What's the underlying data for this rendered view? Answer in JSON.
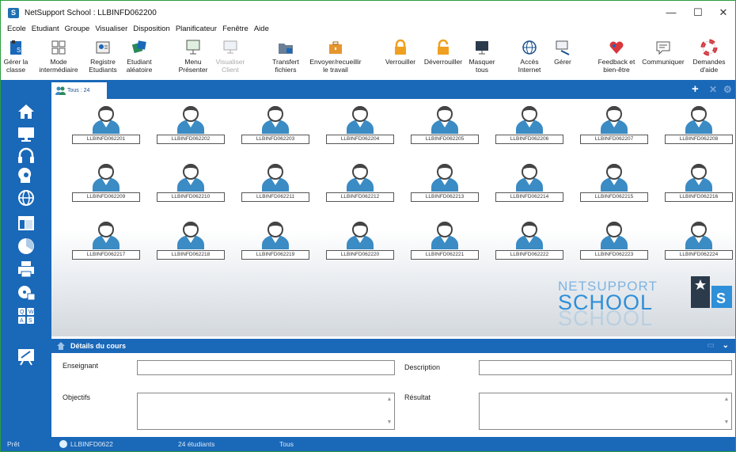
{
  "window": {
    "title": "NetSupport School : LLBINFD062200",
    "app_icon_letter": "S",
    "minimize": "—",
    "maximize": "☐",
    "close": "✕"
  },
  "menu": [
    "Ecole",
    "Etudiant",
    "Groupe",
    "Visualiser",
    "Disposition",
    "Planificateur",
    "Fenêtre",
    "Aide"
  ],
  "ribbon": [
    {
      "l1": "Gérer la",
      "l2": "classe"
    },
    {
      "l1": "Mode",
      "l2": "intermédiaire"
    },
    {
      "l1": "Registre",
      "l2": "Etudiants"
    },
    {
      "l1": "Etudiant",
      "l2": "aléatoire"
    },
    {
      "l1": "Menu",
      "l2": "Présenter"
    },
    {
      "l1": "Visualiser",
      "l2": "Client"
    },
    {
      "l1": "Transfert",
      "l2": "fichiers"
    },
    {
      "l1": "Envoyer/recueillir",
      "l2": "le travail"
    },
    {
      "l1": "Verrouiller",
      "l2": ""
    },
    {
      "l1": "Déverrouiller",
      "l2": ""
    },
    {
      "l1": "Masquer",
      "l2": "tous"
    },
    {
      "l1": "Accès",
      "l2": "Internet"
    },
    {
      "l1": "Gérer",
      "l2": ""
    },
    {
      "l1": "Feedback et",
      "l2": "bien-être"
    },
    {
      "l1": "Communiquer",
      "l2": ""
    },
    {
      "l1": "Demandes",
      "l2": "d'aide"
    }
  ],
  "tab": {
    "label": "Tous : 24",
    "add": "+",
    "close": "✕",
    "settings": "⚙"
  },
  "stations": [
    "LLBINFD062201",
    "LLBINFD062202",
    "LLBINFD062203",
    "LLBINFD062204",
    "LLBINFD062205",
    "LLBINFD062206",
    "LLBINFD062207",
    "LLBINFD062208",
    "LLBINFD062209",
    "LLBINFD062210",
    "LLBINFD062211",
    "LLBINFD062212",
    "LLBINFD062213",
    "LLBINFD062214",
    "LLBINFD062215",
    "LLBINFD062216",
    "LLBINFD062217",
    "LLBINFD062218",
    "LLBINFD062219",
    "LLBINFD062220",
    "LLBINFD062221",
    "LLBINFD062222",
    "LLBINFD062223",
    "LLBINFD062224"
  ],
  "logo": {
    "line1": "NETSUPPORT",
    "line2": "SCHOOL",
    "badge": "S"
  },
  "details": {
    "title": "Détails du cours",
    "teacher_label": "Enseignant",
    "teacher_value": "",
    "description_label": "Description",
    "description_value": "",
    "objectives_label": "Objectifs",
    "objectives_value": "",
    "result_label": "Résultat",
    "result_value": ""
  },
  "status": {
    "ready": "Prêt",
    "machine": "LLBINFD0622",
    "students": "24 étudiants",
    "group": "Tous"
  },
  "colors": {
    "accent": "#1a68b8",
    "avatar": "#3b8bc4",
    "frame": "#2a9d3c"
  }
}
